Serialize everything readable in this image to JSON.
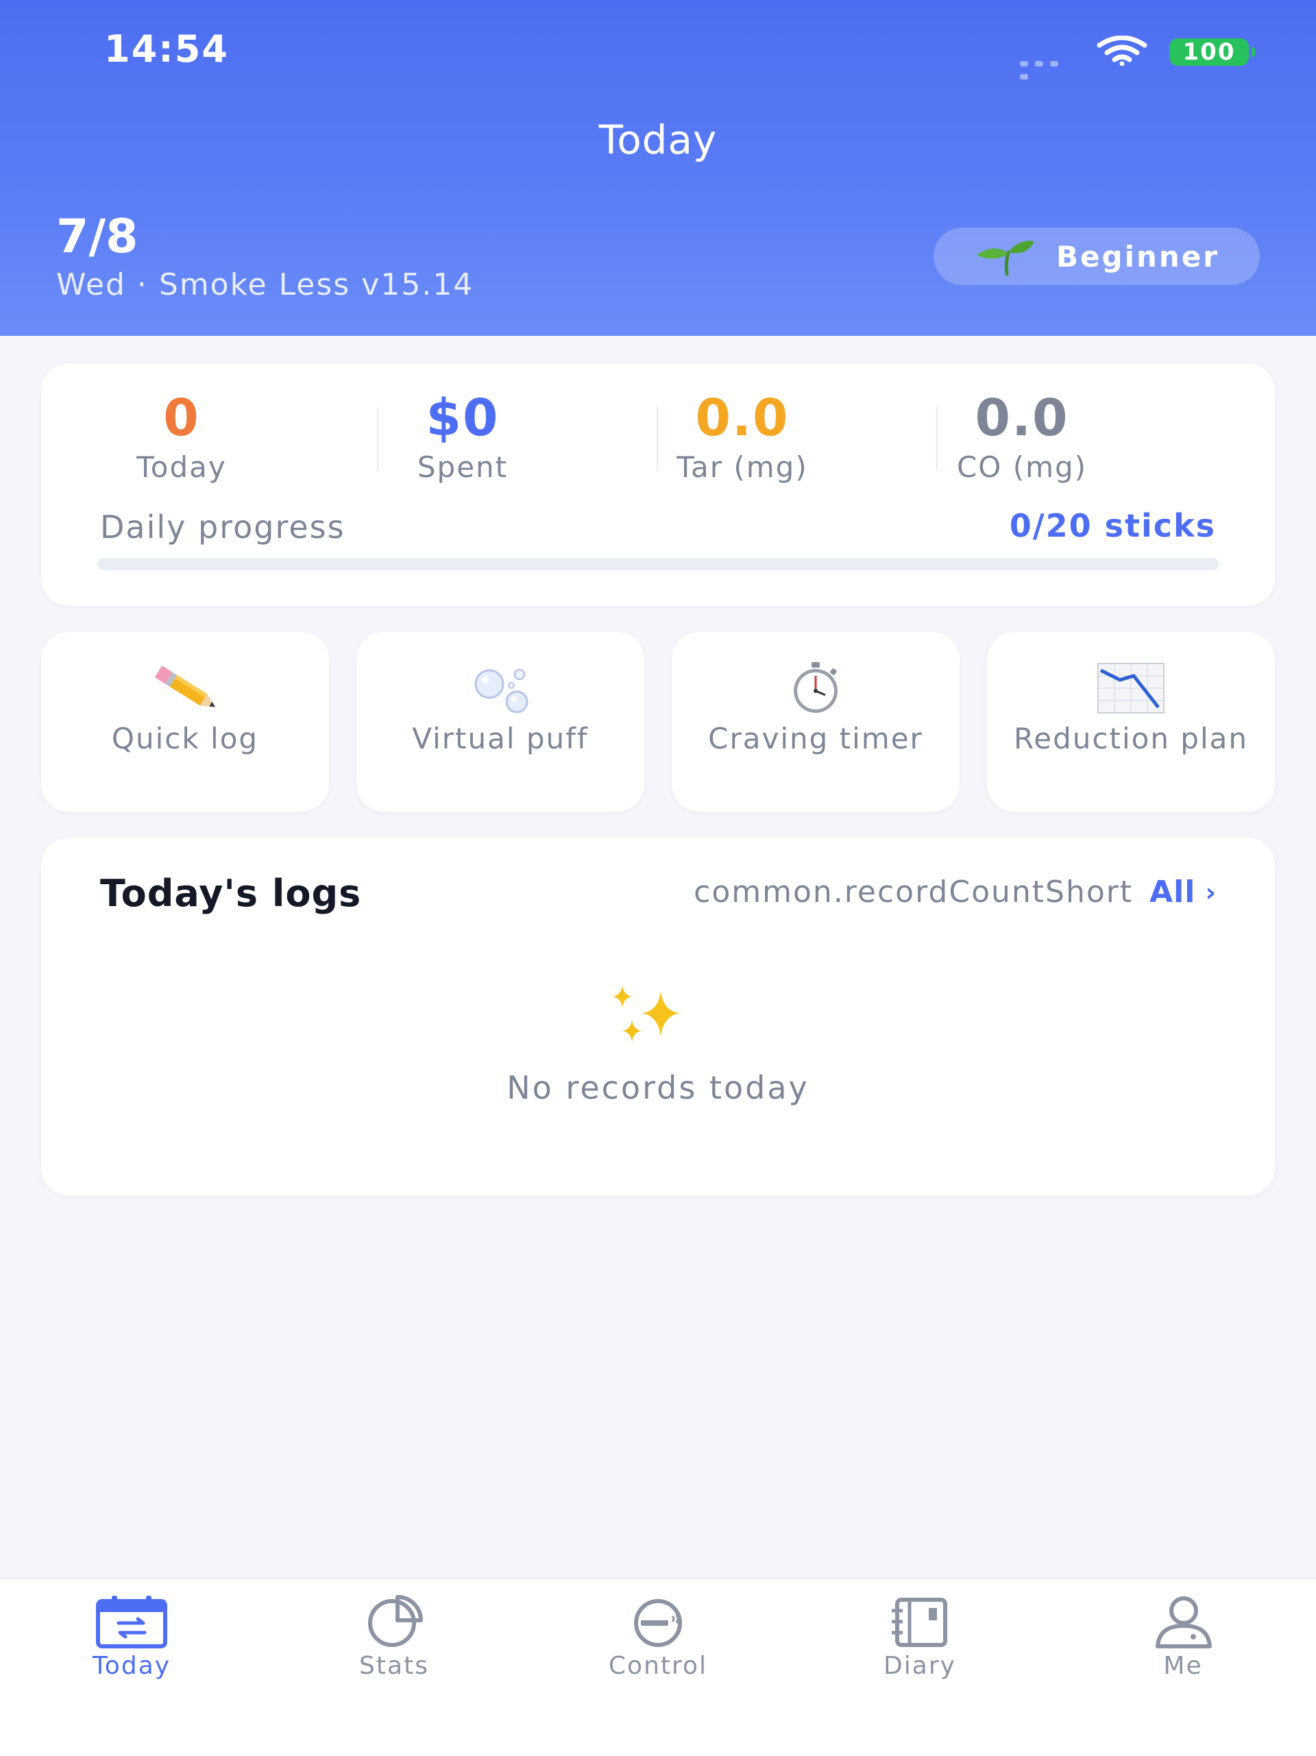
{
  "status_bar": {
    "time": "14:54",
    "battery": "100"
  },
  "header": {
    "title": "Today",
    "date": "7/8",
    "subtitle": "Wed · Smoke Less v15.14",
    "level_badge": "Beginner"
  },
  "stats": {
    "items": [
      {
        "value": "0",
        "label": "Today",
        "color": "#f07a3c"
      },
      {
        "value": "$0",
        "label": "Spent",
        "color": "#4d6ef2"
      },
      {
        "value": "0.0",
        "label": "Tar (mg)",
        "color": "#f5a623"
      },
      {
        "value": "0.0",
        "label": "CO (mg)",
        "color": "#7d8597"
      }
    ],
    "progress_label": "Daily progress",
    "progress_value": "0/20 sticks",
    "progress_fraction": 0
  },
  "actions": [
    {
      "label": "Quick log",
      "icon": "pencil-icon"
    },
    {
      "label": "Virtual puff",
      "icon": "bubbles-icon"
    },
    {
      "label": "Craving timer",
      "icon": "stopwatch-icon"
    },
    {
      "label": "Reduction plan",
      "icon": "chart-decreasing-icon"
    }
  ],
  "logs": {
    "title": "Today's logs",
    "count": "common.recordCountShort",
    "all_label": "All",
    "empty_text": "No records today"
  },
  "tabs": [
    {
      "label": "Today",
      "icon": "calendar-icon",
      "active": true
    },
    {
      "label": "Stats",
      "icon": "pie-chart-icon",
      "active": false
    },
    {
      "label": "Control",
      "icon": "no-smoking-icon",
      "active": false
    },
    {
      "label": "Diary",
      "icon": "notebook-icon",
      "active": false
    },
    {
      "label": "Me",
      "icon": "person-icon",
      "active": false
    }
  ],
  "colors": {
    "accent": "#4d6ef2",
    "background": "#f4f6fb",
    "muted": "#7d8597"
  }
}
